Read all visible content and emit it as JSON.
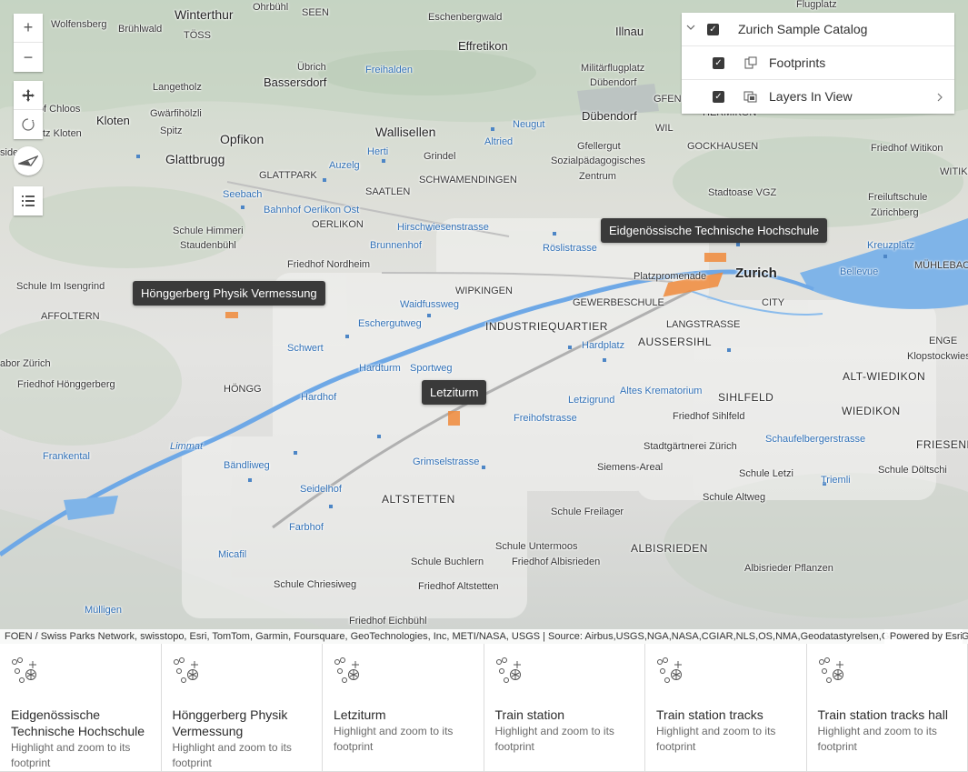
{
  "map": {
    "labels": {
      "winterthur": "Winterthur",
      "ohrbuhl": "Ohrbühl",
      "seen": "SEEN",
      "eschenbergwald": "Eschenbergwald",
      "illnau": "Illnau",
      "flugplatz": "Flugplatz",
      "wolfensberg": "Wolfensberg",
      "bruhlwald": "Brühlwald",
      "toss": "TÖSS",
      "effretikon": "Effretikon",
      "ubrich": "Übrich",
      "freihalden": "Freihalden",
      "militarflugplatz": "Militärflugplatz",
      "dubendorf_small": "Dübendorf",
      "langetholz": "Langetholz",
      "bassersdorf": "Bassersdorf",
      "gfenn": "GFENN",
      "hermikon": "HERMIKON",
      "chloos": "Hof Chloos",
      "gwarfiholzli": "Gwärfihölzli",
      "kloten": "Kloten",
      "dubendorf": "Dübendorf",
      "neugut": "Neugut",
      "wil": "WIL",
      "wallisellen": "Wallisellen",
      "zkloten": "tz Kloten",
      "spitz": "Spitz",
      "opfikon": "Opfikon",
      "altried": "Altried",
      "gfellergut": "Gfellergut",
      "gockhausen": "GOCKHAUSEN",
      "herti": "Herti",
      "grindel": "Grindel",
      "sozialpad": "Sozialpädagogisches",
      "zentrum": "Zentrum",
      "friedhof_witikon": "Friedhof Witikon",
      "witikon": "WITIKO",
      "glattbrugg": "Glattbrugg",
      "auzelg": "Auzelg",
      "glattpark": "GLATTPARK",
      "schwamendingen": "SCHWAMENDINGEN",
      "stadtoase": "Stadtoase VGZ",
      "seebach": "Seebach",
      "saatlen": "SAATLEN",
      "freiluftschule": "Freiluftschule",
      "zurichberg": "Zürichberg",
      "bahnhof_oerlikon": "Bahnhof Oerlikon Ost",
      "oerlikon": "OERLIKON",
      "hirschwiesen": "Hirschwiesenstrasse",
      "schule_himmeri": "Schule Himmeri",
      "staudenbuhl": "Staudenbühl",
      "brunnenhof": "Brunnenhof",
      "roslistrasse": "Röslistrasse",
      "kreuzplatz": "Kreuzplatz",
      "friedhof_nordheim": "Friedhof Nordheim",
      "muhlebach": "MÜHLEBACH",
      "bellevue": "Bellevue",
      "zurich": "Zurich",
      "platzpromenade": "Platzpromenade",
      "schule_isengrind": "Schule Im Isengrind",
      "wipkingen": "WIPKINGEN",
      "waidfussweg": "Waidfussweg",
      "gewerbeschule": "GEWERBESCHULE",
      "city": "CITY",
      "affoltern": "AFFOLTERN",
      "eschergutweg": "Eschergutweg",
      "industriequartier": "INDUSTRIEQUARTIER",
      "langstrasse": "LANGSTRASSE",
      "aussersihl": "AUSSERSIHL",
      "hardplatz": "Hardplatz",
      "enge": "ENGE",
      "schwert": "Schwert",
      "klopstockwiese": "Klopstockwies",
      "labor_zurich": "abor Zürich",
      "hardturm": "Hardturm",
      "sportweg": "Sportweg",
      "alt_wiedikon": "ALT-WIEDIKON",
      "friedhof_honggerberg": "Friedhof Hönggerberg",
      "hongg": "HÖNGG",
      "hardhof": "Hardhof",
      "altes_krematorium": "Altes Krematorium",
      "sihlfeld": "SIHLFELD",
      "letzigrund": "Letzigrund",
      "wiedikon": "WIEDIKON",
      "friedhof_sihlfeld": "Friedhof Sihlfeld",
      "freihofstrasse": "Freihofstrasse",
      "limmat": "Limmat",
      "schaufelberger": "Schaufelbergerstrasse",
      "friesenb": "FRIESENB",
      "frankental": "Frankental",
      "stadtgartnerei": "Stadtgärtnerei Zürich",
      "grimselstrasse": "Grimselstrasse",
      "siemens_areal": "Siemens-Areal",
      "bandliweg": "Bändliweg",
      "schule_letzi": "Schule Letzi",
      "schule_doltschi": "Schule Döltschi",
      "triemli": "Triemli",
      "seidelhof": "Seidelhof",
      "schule_altweg": "Schule Altweg",
      "altstetten": "ALTSTETTEN",
      "schule_freilager": "Schule Freilager",
      "farbhof": "Farbhof",
      "schule_untermoos": "Schule Untermoos",
      "albisrieden": "ALBISRIEDEN",
      "micafil": "Micafil",
      "schule_buchlern": "Schule Buchlern",
      "friedhof_albisrieden": "Friedhof Albisrieden",
      "albisrieder_pflanzen": "Albisrieder Pflanzen",
      "schule_chriesiweg": "Schule Chriesiweg",
      "friedhof_altstetten": "Friedhof Altstetten",
      "mulligen": "Mülligen",
      "friedhof_eichbuhl": "Friedhof Eichbühl",
      "sidenz": "side"
    },
    "callouts": {
      "eth": "Eidgenössische Technische Hochschule",
      "hongg_physik": "Hönggerberg Physik Vermessung",
      "letziturm": "Letziturm"
    },
    "colors": {
      "water": "#7fb4e8",
      "river": "#6ea8e6",
      "footprint": "#f08a3a",
      "callout_bg": "#3a3a3a"
    }
  },
  "controls": {
    "zoom_in": "+",
    "zoom_out": "−",
    "icons": [
      "pan-icon",
      "rotate-icon",
      "compass-icon",
      "layer-list-icon"
    ]
  },
  "layer_list": {
    "catalog": "Zurich Sample Catalog",
    "footprints": "Footprints",
    "layers_in_view": "Layers In View"
  },
  "attribution": {
    "text": "FOEN / Swiss Parks Network, swisstopo, Esri, TomTom, Garmin, Foursquare, GeoTechnologies, Inc, METI/NASA, USGS | Source: Airbus,USGS,NGA,NASA,CGIAR,NLS,OS,NMA,Geodatastyrelsen,GSA,GSI and the GIS User Community",
    "powered": "Powered by Esri"
  },
  "cards": [
    {
      "title": "Eidgenössische Technische Hochschule",
      "desc": "Highlight and zoom to its footprint"
    },
    {
      "title": "Hönggerberg Physik Vermessung",
      "desc": "Highlight and zoom to its footprint"
    },
    {
      "title": "Letziturm",
      "desc": "Highlight and zoom to its footprint"
    },
    {
      "title": "Train station",
      "desc": "Highlight and zoom to its footprint"
    },
    {
      "title": "Train station tracks",
      "desc": "Highlight and zoom to its footprint"
    },
    {
      "title": "Train station tracks hall",
      "desc": "Highlight and zoom to its footprint"
    }
  ]
}
